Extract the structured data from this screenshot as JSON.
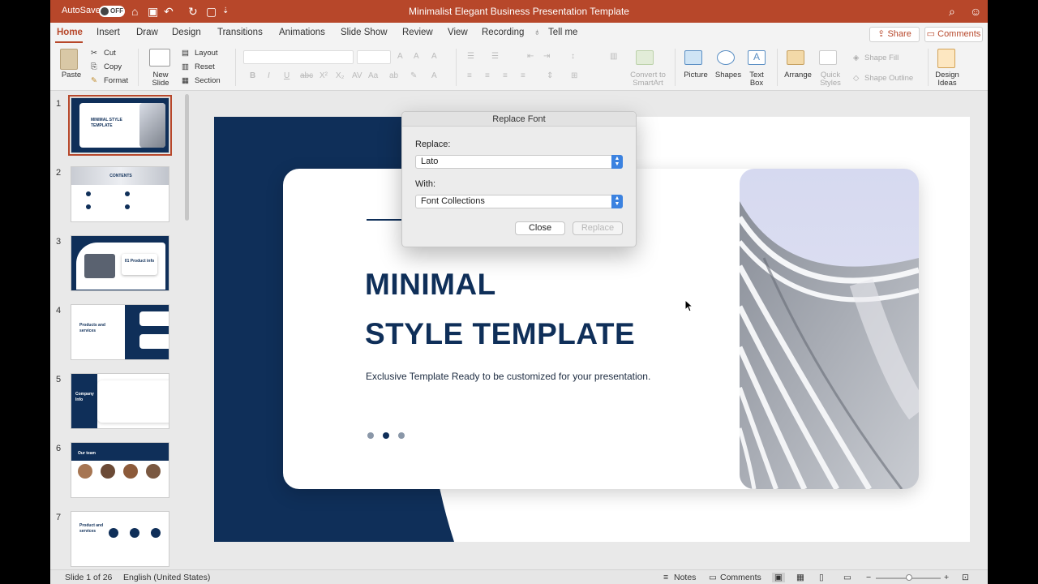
{
  "titlebar": {
    "autosave_label": "AutoSave",
    "autosave_state": "OFF",
    "document_title": "Minimalist Elegant Business Presentation Template"
  },
  "tabs": [
    "Home",
    "Insert",
    "Draw",
    "Design",
    "Transitions",
    "Animations",
    "Slide Show",
    "Review",
    "View",
    "Recording",
    "Tell me"
  ],
  "actions": {
    "share": "Share",
    "comments": "Comments"
  },
  "ribbon": {
    "paste": "Paste",
    "cut": "Cut",
    "copy": "Copy",
    "format": "Format",
    "new_slide_1": "New",
    "new_slide_2": "Slide",
    "layout": "Layout",
    "reset": "Reset",
    "section": "Section",
    "convert_1": "Convert to",
    "convert_2": "SmartArt",
    "picture": "Picture",
    "shapes": "Shapes",
    "textbox_1": "Text",
    "textbox_2": "Box",
    "arrange": "Arrange",
    "quick_1": "Quick",
    "quick_2": "Styles",
    "shape_fill": "Shape Fill",
    "shape_outline": "Shape Outline",
    "design_1": "Design",
    "design_2": "Ideas"
  },
  "thumbnails": [
    {
      "num": "1",
      "title": "MINIMAL STYLE TEMPLATE"
    },
    {
      "num": "2",
      "title": "CONTENTS"
    },
    {
      "num": "3",
      "title": "01 Product info"
    },
    {
      "num": "4",
      "title": "Products and services"
    },
    {
      "num": "5",
      "title": "Company Info"
    },
    {
      "num": "6",
      "title": "Our team"
    },
    {
      "num": "7",
      "title": "Product and services"
    }
  ],
  "slide": {
    "title_line1": "MINIMAL",
    "title_line2": "STYLE TEMPLATE",
    "subtitle": "Exclusive Template Ready to be customized for your presentation.",
    "colors": {
      "navy": "#0f2f59",
      "dot_gray": "#8a97a8"
    }
  },
  "dialog": {
    "title": "Replace Font",
    "replace_label": "Replace:",
    "replace_value": "Lato",
    "with_label": "With:",
    "with_value": "Font Collections",
    "close_button": "Close",
    "replace_button": "Replace"
  },
  "statusbar": {
    "slide_info": "Slide 1 of 26",
    "language": "English (United States)",
    "notes": "Notes",
    "comments": "Comments"
  },
  "colors": {
    "accent": "#b7472a",
    "ribbon_bg": "#f3f3f3"
  }
}
